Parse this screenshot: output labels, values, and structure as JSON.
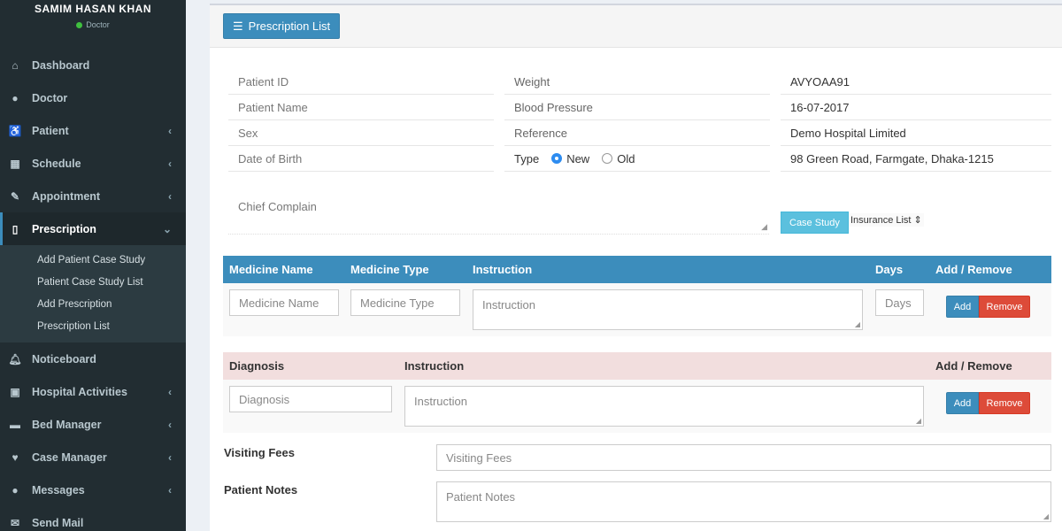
{
  "user": {
    "name": "SAMIM HASAN KHAN",
    "role": "Doctor",
    "status_color": "#3fbf3f"
  },
  "sidebar": {
    "items": [
      {
        "label": "Dashboard",
        "icon": "home-icon",
        "arrow": false
      },
      {
        "label": "Doctor",
        "icon": "user-md-icon",
        "arrow": false
      },
      {
        "label": "Patient",
        "icon": "wheelchair-icon",
        "arrow": true
      },
      {
        "label": "Schedule",
        "icon": "calendar-icon",
        "arrow": true
      },
      {
        "label": "Appointment",
        "icon": "edit-icon",
        "arrow": true
      },
      {
        "label": "Prescription",
        "icon": "book-icon",
        "arrow": true,
        "active": true
      },
      {
        "label": "Noticeboard",
        "icon": "bell-icon",
        "arrow": false
      },
      {
        "label": "Hospital Activities",
        "icon": "hospital-icon",
        "arrow": true
      },
      {
        "label": "Bed Manager",
        "icon": "bed-icon",
        "arrow": true
      },
      {
        "label": "Case Manager",
        "icon": "heartbeat-icon",
        "arrow": true
      },
      {
        "label": "Messages",
        "icon": "comments-icon",
        "arrow": true
      },
      {
        "label": "Send Mail",
        "icon": "envelope-icon",
        "arrow": false
      }
    ],
    "submenu": [
      "Add Patient Case Study",
      "Patient Case Study List",
      "Add Prescription",
      "Prescription List"
    ]
  },
  "header": {
    "button_label": "Prescription List"
  },
  "info": {
    "rows": [
      [
        "Patient ID",
        "Weight",
        "AVYOAA91"
      ],
      [
        "Patient  Name",
        "Blood Pressure",
        "16-07-2017"
      ],
      [
        "Sex",
        "Reference",
        "Demo Hospital Limited"
      ],
      [
        "Date of Birth",
        "",
        "98 Green Road, Farmgate, Dhaka-1215"
      ]
    ],
    "type_label": "Type",
    "type_options": [
      "New",
      "Old"
    ],
    "type_selected": "New"
  },
  "chief": {
    "placeholder": "Chief Complain"
  },
  "case_study_button": "Case Study",
  "insurance_select": "Insurance List",
  "medicine_table": {
    "headers": [
      "Medicine Name",
      "Medicine Type",
      "Instruction",
      "Days",
      "Add / Remove"
    ],
    "placeholders": [
      "Medicine Name",
      "Medicine Type",
      "Instruction",
      "Days"
    ],
    "add": "Add",
    "remove": "Remove"
  },
  "diagnosis_table": {
    "headers": [
      "Diagnosis",
      "Instruction",
      "Add / Remove"
    ],
    "placeholders": [
      "Diagnosis",
      "Instruction"
    ],
    "add": "Add",
    "remove": "Remove"
  },
  "fees": {
    "label": "Visiting Fees",
    "placeholder": "Visiting Fees"
  },
  "notes": {
    "label": "Patient Notes",
    "placeholder": "Patient Notes"
  },
  "colors": {
    "sidebar": "#222d32",
    "primary": "#3c8dbc",
    "danger": "#dd4b39",
    "info": "#5bc0de",
    "diagnosis_header": "#f2dede"
  }
}
